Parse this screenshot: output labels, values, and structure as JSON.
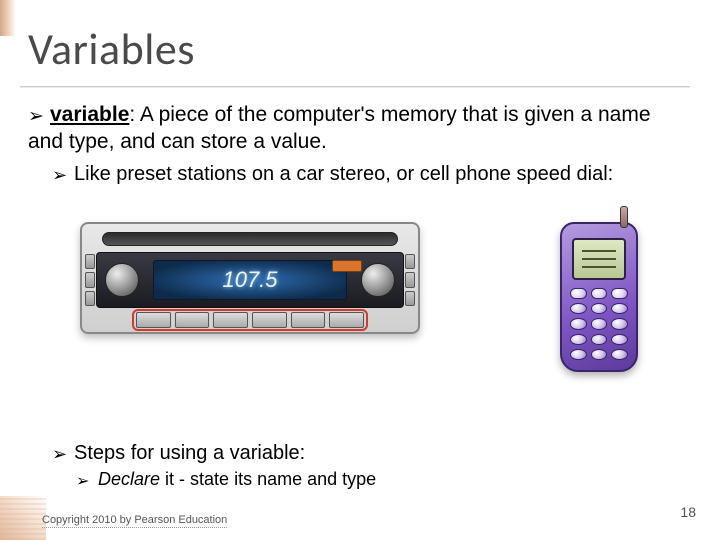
{
  "title": "Variables",
  "bullets": {
    "b1_term": "variable",
    "b1_rest": ": A piece of the computer's memory that is given a name and type, and can store a value.",
    "b2": "Like preset stations on a car stereo, or cell phone speed dial:",
    "b3": "Steps for using a variable:",
    "b4_emph": "Declare",
    "b4_mid": " it",
    "b4_rest": "   - state its name and type"
  },
  "stereo": {
    "frequency": "107.5"
  },
  "footer": {
    "copyright": "Copyright 2010 by Pearson Education",
    "page": "18"
  }
}
